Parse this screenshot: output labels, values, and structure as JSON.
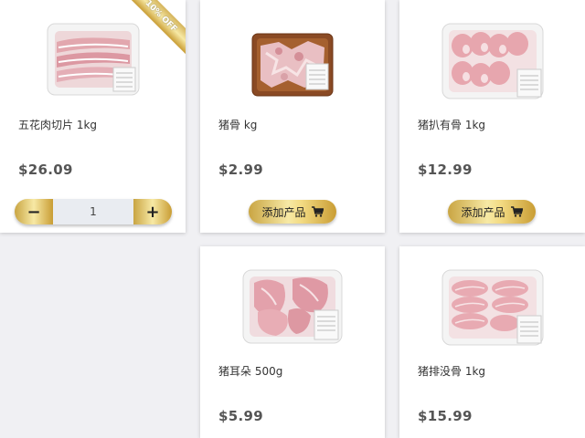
{
  "products": [
    {
      "name": "五花肉切片 1kg",
      "price": "$26.09",
      "badge": "10% OFF",
      "quantity": "1"
    },
    {
      "name": "猪骨 kg",
      "price": "$2.99",
      "button_label": "添加产品"
    },
    {
      "name": "猪扒有骨 1kg",
      "price": "$12.99",
      "button_label": "添加产品"
    },
    {
      "name": "猪耳朵 500g",
      "price": "$5.99"
    },
    {
      "name": "猪排没骨 1kg",
      "price": "$15.99"
    }
  ],
  "colors": {
    "gold_light": "#f7e9a5",
    "gold_dark": "#c99d34",
    "price": "#555555"
  },
  "icons": {
    "cart": "cart-icon",
    "minus": "minus-icon",
    "plus": "plus-icon"
  }
}
